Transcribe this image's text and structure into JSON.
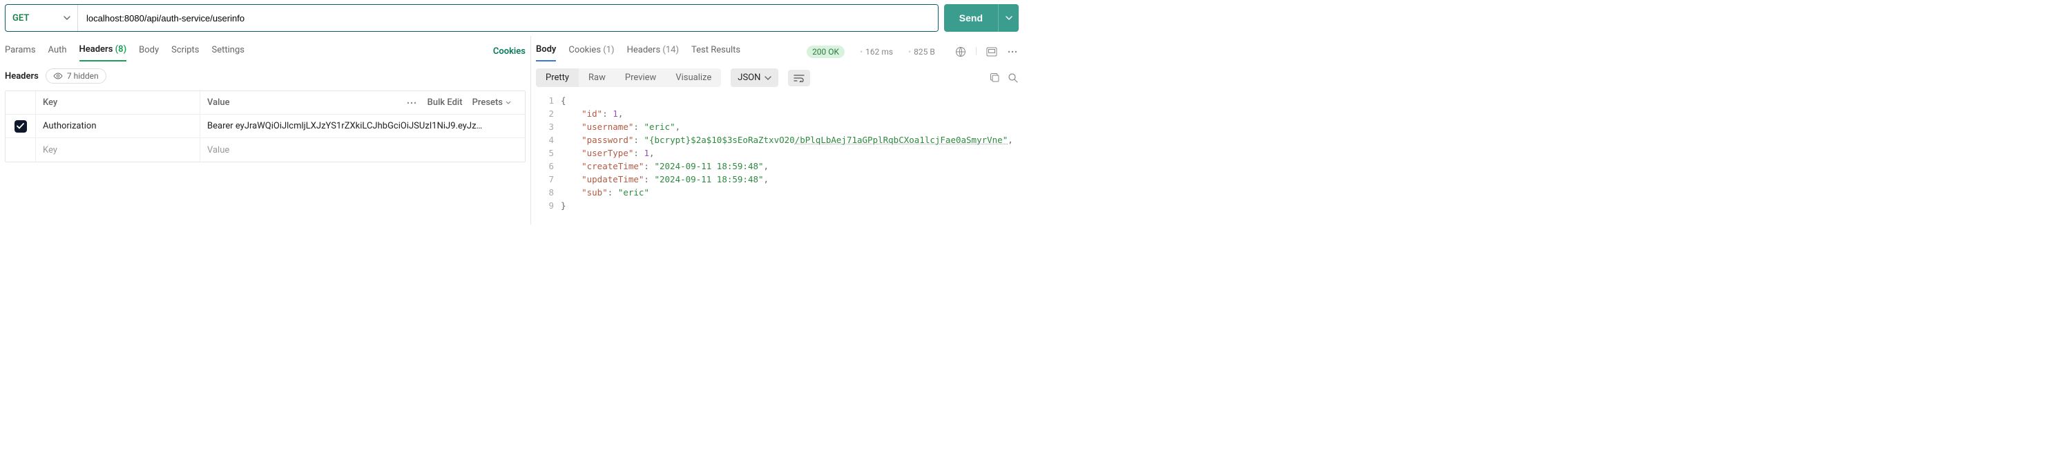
{
  "request": {
    "method": "GET",
    "url": "localhost:8080/api/auth-service/userinfo",
    "send_label": "Send"
  },
  "left_tabs": {
    "params": "Params",
    "auth": "Auth",
    "headers_label": "Headers",
    "headers_count": "(8)",
    "body": "Body",
    "scripts": "Scripts",
    "settings": "Settings",
    "cookies": "Cookies"
  },
  "headers_section": {
    "title": "Headers",
    "hidden_label": "7 hidden",
    "col_key": "Key",
    "col_value": "Value",
    "bulk_edit": "Bulk Edit",
    "presets": "Presets",
    "row_key": "Authorization",
    "row_value": "Bearer eyJraWQiOiJlcmljLXJzYS1rZXkiLCJhbGciOiJSUzI1NiJ9.eyJz…",
    "placeholder_key": "Key",
    "placeholder_value": "Value"
  },
  "right_tabs": {
    "body": "Body",
    "cookies_label": "Cookies",
    "cookies_count": "(1)",
    "headers_label": "Headers",
    "headers_count": "(14)",
    "tests": "Test Results"
  },
  "status": {
    "code": "200 OK",
    "time": "162 ms",
    "size": "825 B"
  },
  "resp_view": {
    "pretty": "Pretty",
    "raw": "Raw",
    "preview": "Preview",
    "visualize": "Visualize",
    "format": "JSON"
  },
  "json": {
    "l1": "{",
    "l2_key": "\"id\"",
    "l2_val": "1",
    "l3_key": "\"username\"",
    "l3_val": "\"eric\"",
    "l4_key": "\"password\"",
    "l4_val_a": "\"{bcrypt}$2a$10$3sEoRaZtxvO20",
    "l4_val_b": "/bPlqLbAej71aGPplRqbCXoa1lcjFae0aSmyrVne\"",
    "l5_key": "\"userType\"",
    "l5_val": "1",
    "l6_key": "\"createTime\"",
    "l6_val": "\"2024-09-11 18:59:48\"",
    "l7_key": "\"updateTime\"",
    "l7_val": "\"2024-09-11 18:59:48\"",
    "l8_key": "\"sub\"",
    "l8_val": "\"eric\"",
    "l9": "}"
  }
}
